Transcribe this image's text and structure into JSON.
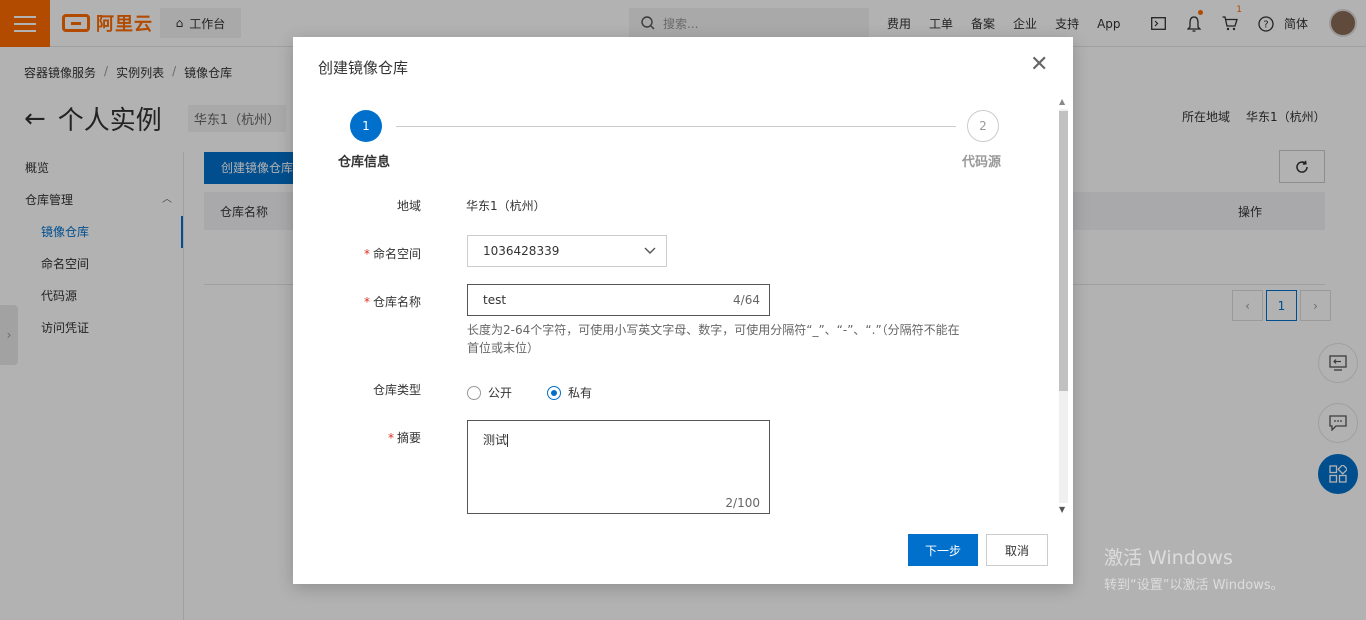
{
  "topbar": {
    "logo_text": "阿里云",
    "workbench_label": "工作台",
    "search_placeholder": "搜索...",
    "links": [
      "费用",
      "工单",
      "备案",
      "企业",
      "支持",
      "App"
    ],
    "cart_badge": "1",
    "lang": "简体"
  },
  "breadcrumb": [
    "容器镜像服务",
    "实例列表",
    "镜像仓库"
  ],
  "page": {
    "title": "个人实例",
    "region_pill": "华东1（杭州）",
    "region_label": "所在地域",
    "region_value": "华东1（杭州）"
  },
  "sidenav": {
    "overview": "概览",
    "repo_mgmt": "仓库管理",
    "image_repo": "镜像仓库",
    "namespace": "命名空间",
    "code_source": "代码源",
    "credential": "访问凭证"
  },
  "main": {
    "create_button": "创建镜像仓库",
    "col_repo_name": "仓库名称",
    "col_action": "操作",
    "page_current": "1"
  },
  "dialog": {
    "title": "创建镜像仓库",
    "steps": [
      {
        "num": "1",
        "label": "仓库信息"
      },
      {
        "num": "2",
        "label": "代码源"
      }
    ],
    "fields": {
      "region_label": "地域",
      "region_value": "华东1（杭州）",
      "namespace_label": "命名空间",
      "namespace_value": "1036428339",
      "repo_name_label": "仓库名称",
      "repo_name_value": "test",
      "repo_name_count": "4/64",
      "repo_name_hint": "长度为2-64个字符，可使用小写英文字母、数字，可使用分隔符“_”、“-”、“.”（分隔符不能在首位或末位）",
      "repo_type_label": "仓库类型",
      "repo_type_public": "公开",
      "repo_type_private": "私有",
      "summary_label": "摘要",
      "summary_value": "测试",
      "summary_count": "2/100"
    },
    "next_button": "下一步",
    "cancel_button": "取消"
  },
  "watermark": {
    "line1": "激活 Windows",
    "line2": "转到“设置”以激活 Windows。"
  },
  "colors": {
    "brand": "#ff6a00",
    "primary": "#0070cc",
    "required": "#d93026"
  }
}
